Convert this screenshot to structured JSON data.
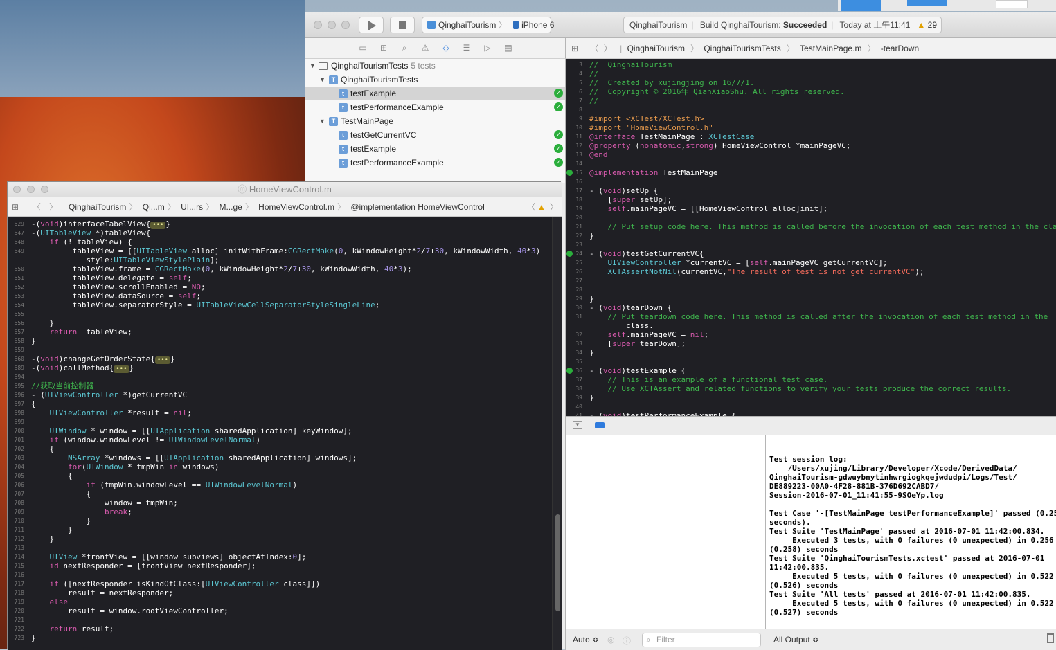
{
  "xcode": {
    "scheme_project": "QinghaiTourism",
    "scheme_device": "iPhone 6",
    "status_project": "QinghaiTourism",
    "status_build_prefix": "Build QinghaiTourism:",
    "status_build_result": "Succeeded",
    "status_time": "Today at 上午11:41",
    "warning_count": "29"
  },
  "navigator": {
    "rows": [
      {
        "label": "QinghaiTourismTests",
        "extra": "5 tests"
      },
      {
        "label": "QinghaiTourismTests"
      },
      {
        "label": "testExample"
      },
      {
        "label": "testPerformanceExample"
      },
      {
        "label": "TestMainPage"
      },
      {
        "label": "testGetCurrentVC"
      },
      {
        "label": "testExample"
      },
      {
        "label": "testPerformanceExample"
      }
    ]
  },
  "right_jump": {
    "items": [
      "QinghaiTourism",
      "QinghaiTourismTests",
      "TestMainPage.m",
      "-tearDown"
    ]
  },
  "right_code": [
    {
      "n": "3",
      "t": "//  QinghaiTourism"
    },
    {
      "n": "4",
      "t": "//"
    },
    {
      "n": "5",
      "t": "//  Created by xujingjing on 16/7/1."
    },
    {
      "n": "6",
      "t": "//  Copyright © 2016年 QianXiaoShu. All rights reserved."
    },
    {
      "n": "7",
      "t": "//"
    },
    {
      "n": "8",
      "t": ""
    },
    {
      "n": "9",
      "t": "#import <XCTest/XCTest.h>"
    },
    {
      "n": "10",
      "t": "#import \"HomeViewControl.h\""
    },
    {
      "n": "11",
      "t": "@interface TestMainPage : XCTestCase"
    },
    {
      "n": "12",
      "t": "@property (nonatomic,strong) HomeViewControl *mainPageVC;"
    },
    {
      "n": "13",
      "t": "@end"
    },
    {
      "n": "14",
      "t": ""
    },
    {
      "n": "15",
      "t": "@implementation TestMainPage"
    },
    {
      "n": "16",
      "t": ""
    },
    {
      "n": "17",
      "t": "- (void)setUp {"
    },
    {
      "n": "18",
      "t": "    [super setUp];"
    },
    {
      "n": "19",
      "t": "    self.mainPageVC = [[HomeViewControl alloc]init];"
    },
    {
      "n": "20",
      "t": ""
    },
    {
      "n": "21",
      "t": "    // Put setup code here. This method is called before the invocation of each test method in the cla"
    },
    {
      "n": "22",
      "t": "}"
    },
    {
      "n": "23",
      "t": ""
    },
    {
      "n": "24",
      "t": "- (void)testGetCurrentVC{"
    },
    {
      "n": "25",
      "t": "    UIViewController *currentVC = [self.mainPageVC getCurrentVC];"
    },
    {
      "n": "26",
      "t": "    XCTAssertNotNil(currentVC,\"The result of test is not get currentVC\");"
    },
    {
      "n": "27",
      "t": ""
    },
    {
      "n": "28",
      "t": ""
    },
    {
      "n": "29",
      "t": "}"
    },
    {
      "n": "30",
      "t": "- (void)tearDown {"
    },
    {
      "n": "31",
      "t": "    // Put teardown code here. This method is called after the invocation of each test method in the"
    },
    {
      "n": "",
      "t": "        class."
    },
    {
      "n": "32",
      "t": "    self.mainPageVC = nil;"
    },
    {
      "n": "33",
      "t": "    [super tearDown];"
    },
    {
      "n": "34",
      "t": "}"
    },
    {
      "n": "35",
      "t": ""
    },
    {
      "n": "36",
      "t": "- (void)testExample {"
    },
    {
      "n": "37",
      "t": "    // This is an example of a functional test case."
    },
    {
      "n": "38",
      "t": "    // Use XCTAssert and related functions to verify your tests produce the correct results."
    },
    {
      "n": "39",
      "t": "}"
    },
    {
      "n": "40",
      "t": ""
    },
    {
      "n": "41",
      "t": "- (void)testPerformanceExample {"
    }
  ],
  "console": {
    "text": "Test session log:\n    /Users/xujing/Library/Developer/Xcode/DerivedData/\nQinghaiTourism-gdwuybnytinhwrgiogkqejwdudpi/Logs/Test/\nDE889223-00A0-4F28-881B-376D692CABD7/\nSession-2016-07-01_11:41:55-9SOeYp.log\n\nTest Case '-[TestMainPage testPerformanceExample]' passed (0.25\nseconds).\nTest Suite 'TestMainPage' passed at 2016-07-01 11:42:00.834.\n     Executed 3 tests, with 0 failures (0 unexpected) in 0.256\n(0.258) seconds\nTest Suite 'QinghaiTourismTests.xctest' passed at 2016-07-01\n11:42:00.835.\n     Executed 5 tests, with 0 failures (0 unexpected) in 0.522\n(0.526) seconds\nTest Suite 'All tests' passed at 2016-07-01 11:42:00.835.\n     Executed 5 tests, with 0 failures (0 unexpected) in 0.522\n(0.527) seconds"
  },
  "debug_footer": {
    "auto": "Auto ≎",
    "filter_placeholder": "Filter",
    "all_output": "All Output ≎"
  },
  "win2": {
    "title": "HomeViewControl.m",
    "jump": [
      "QinghaiTourism",
      "Qi...m",
      "UI...rs",
      "M...ge",
      "HomeViewControl.m",
      "@implementation HomeViewControl"
    ]
  },
  "left_code": [
    {
      "n": "629",
      "t": "-(void)interfaceTabelView{",
      "fold": "•••",
      "after": "}"
    },
    {
      "n": "647",
      "t": "-(UITableView *)tableView{"
    },
    {
      "n": "648",
      "t": "    if (!_tableView) {"
    },
    {
      "n": "649",
      "t": "        _tableView = [[UITableView alloc] initWithFrame:CGRectMake(0, kWindowHeight*2/7+30, kWindowWidth, 40*3)"
    },
    {
      "n": "",
      "t": "            style:UITableViewStylePlain];"
    },
    {
      "n": "650",
      "t": "        _tableView.frame = CGRectMake(0, kWindowHeight*2/7+30, kWindowWidth, 40*3);"
    },
    {
      "n": "651",
      "t": "        _tableView.delegate = self;"
    },
    {
      "n": "652",
      "t": "        _tableView.scrollEnabled = NO;"
    },
    {
      "n": "653",
      "t": "        _tableView.dataSource = self;"
    },
    {
      "n": "654",
      "t": "        _tableView.separatorStyle = UITableViewCellSeparatorStyleSingleLine;"
    },
    {
      "n": "655",
      "t": ""
    },
    {
      "n": "656",
      "t": "    }"
    },
    {
      "n": "657",
      "t": "    return _tableView;"
    },
    {
      "n": "658",
      "t": "}"
    },
    {
      "n": "659",
      "t": ""
    },
    {
      "n": "660",
      "t": "-(void)changeGetOrderState{",
      "fold": "•••",
      "after": "}"
    },
    {
      "n": "689",
      "t": "-(void)callMethod{",
      "fold": "•••",
      "after": "}"
    },
    {
      "n": "694",
      "t": ""
    },
    {
      "n": "695",
      "t": "//获取当前控制器"
    },
    {
      "n": "696",
      "t": "- (UIViewController *)getCurrentVC"
    },
    {
      "n": "697",
      "t": "{"
    },
    {
      "n": "698",
      "t": "    UIViewController *result = nil;"
    },
    {
      "n": "699",
      "t": ""
    },
    {
      "n": "700",
      "t": "    UIWindow * window = [[UIApplication sharedApplication] keyWindow];"
    },
    {
      "n": "701",
      "t": "    if (window.windowLevel != UIWindowLevelNormal)"
    },
    {
      "n": "702",
      "t": "    {"
    },
    {
      "n": "703",
      "t": "        NSArray *windows = [[UIApplication sharedApplication] windows];"
    },
    {
      "n": "704",
      "t": "        for(UIWindow * tmpWin in windows)"
    },
    {
      "n": "705",
      "t": "        {"
    },
    {
      "n": "706",
      "t": "            if (tmpWin.windowLevel == UIWindowLevelNormal)"
    },
    {
      "n": "707",
      "t": "            {"
    },
    {
      "n": "708",
      "t": "                window = tmpWin;"
    },
    {
      "n": "709",
      "t": "                break;"
    },
    {
      "n": "710",
      "t": "            }"
    },
    {
      "n": "711",
      "t": "        }"
    },
    {
      "n": "712",
      "t": "    }"
    },
    {
      "n": "713",
      "t": ""
    },
    {
      "n": "714",
      "t": "    UIView *frontView = [[window subviews] objectAtIndex:0];"
    },
    {
      "n": "715",
      "t": "    id nextResponder = [frontView nextResponder];"
    },
    {
      "n": "716",
      "t": ""
    },
    {
      "n": "717",
      "t": "    if ([nextResponder isKindOfClass:[UIViewController class]])"
    },
    {
      "n": "718",
      "t": "        result = nextResponder;"
    },
    {
      "n": "719",
      "t": "    else"
    },
    {
      "n": "720",
      "t": "        result = window.rootViewController;"
    },
    {
      "n": "721",
      "t": ""
    },
    {
      "n": "722",
      "t": "    return result;"
    },
    {
      "n": "723",
      "t": "}"
    }
  ]
}
